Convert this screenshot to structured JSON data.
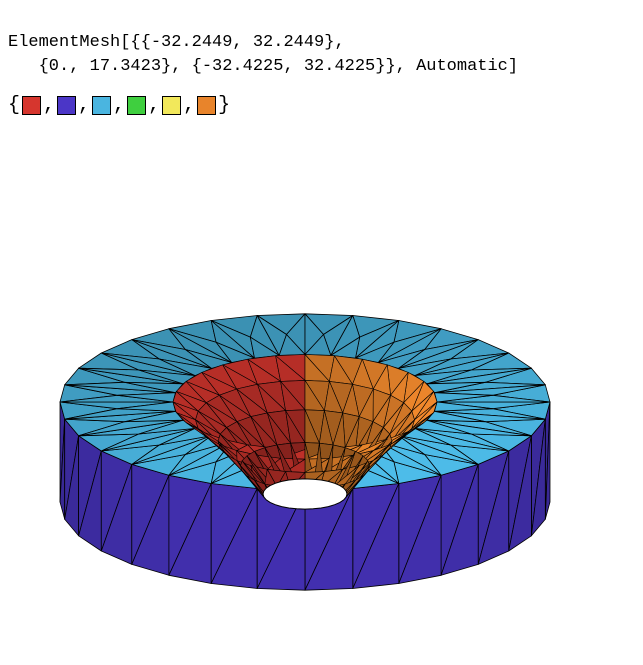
{
  "code": {
    "head": "ElementMesh",
    "ranges": {
      "x": [
        -32.2449,
        32.2449
      ],
      "y": [
        0.0,
        17.3423
      ],
      "z": [
        -32.4225,
        32.4225
      ]
    },
    "option": "Automatic",
    "line1": "ElementMesh[{{-32.2449, 32.2449},",
    "line2": "   {0., 17.3423}, {-32.4225, 32.4225}}, Automatic]"
  },
  "swatches": {
    "open": "{",
    "close": "}",
    "sep": ", ",
    "colors": [
      "#d6362e",
      "#4b36c7",
      "#4ab5e0",
      "#3fcf3f",
      "#f2e85b",
      "#e8842b"
    ]
  },
  "mesh": {
    "description": "3D triangulated element mesh: thick washer (annulus) with a concave bowl recessed in its center and a through-hole at the bottom of the bowl.",
    "faces": {
      "top_annulus": "#4ab5e0",
      "outer_wall_front": "#4b36c7",
      "outer_wall_back_hint": "#3fcf3f",
      "bowl_left": "#d6362e",
      "bowl_right": "#e8842b",
      "hole": "#ffffff"
    },
    "edge_color": "#000000",
    "approx_radial_segments_outer": 32,
    "approx_radial_segments_inner": 28
  }
}
